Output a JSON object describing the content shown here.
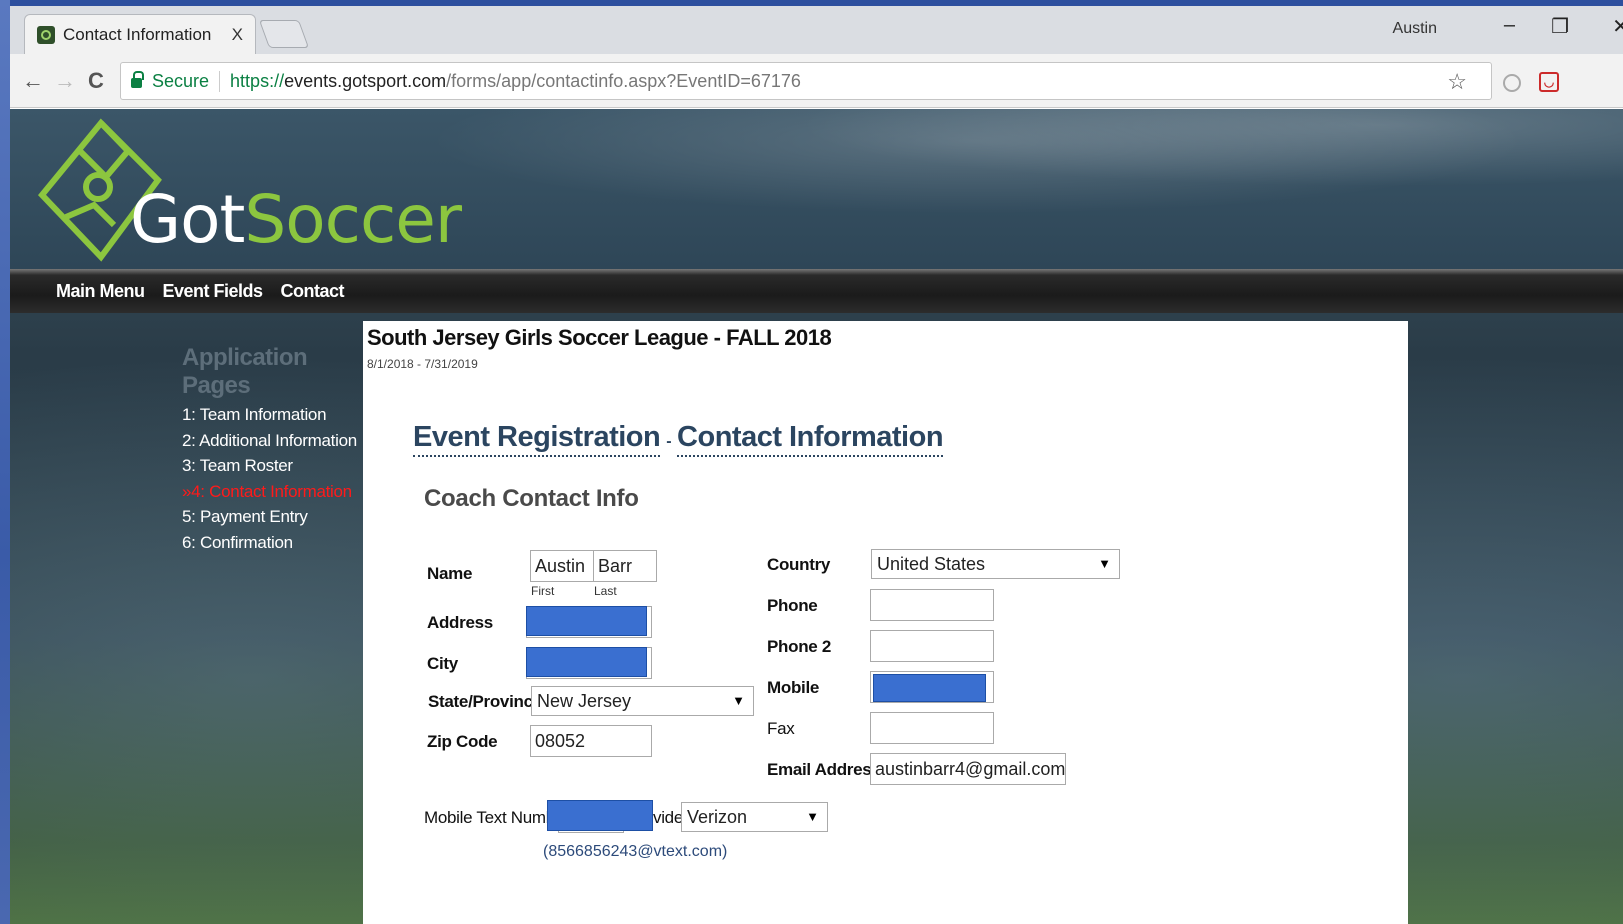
{
  "browser": {
    "tab_title": "Contact Information",
    "tab_close": "X",
    "user": "Austin",
    "minimize": "–",
    "restore": "❐",
    "close": "✕",
    "secure": "Secure",
    "url_scheme": "https://",
    "url_host": "events.gotsport.com",
    "url_path": "/forms/app/contactinfo.aspx?EventID=67176",
    "back": "←",
    "forward": "→",
    "reload": "C",
    "star": "☆"
  },
  "site": {
    "logo_got": "Got",
    "logo_soccer": "Soccer",
    "nav": [
      "Main Menu",
      "Event Fields",
      "Contact"
    ]
  },
  "sidebar": {
    "title": "Application Pages",
    "items": [
      {
        "label": "1: Team Information"
      },
      {
        "label": "2: Additional Information"
      },
      {
        "label": "3: Team Roster"
      },
      {
        "label": "»4: Contact Information",
        "active": true
      },
      {
        "label": "5: Payment Entry"
      },
      {
        "label": "6: Confirmation"
      }
    ]
  },
  "event": {
    "title": "South Jersey Girls Soccer League - FALL 2018",
    "dates": "8/1/2018 - 7/31/2019"
  },
  "heading": {
    "part1": "Event Registration",
    "sep": "-",
    "part2": "Contact Information"
  },
  "section_title": "Coach Contact Info",
  "form": {
    "name_label": "Name",
    "first_value": "Austin",
    "last_value": "Barr",
    "first_sub": "First",
    "last_sub": "Last",
    "address_label": "Address",
    "city_label": "City",
    "state_label": "State/Province",
    "state_value": "New Jersey",
    "zip_label": "Zip Code",
    "zip_value": "08052",
    "country_label": "Country",
    "country_value": "United States",
    "phone_label": "Phone",
    "phone2_label": "Phone 2",
    "mobile_label": "Mobile",
    "fax_label": "Fax",
    "email_label": "Email Address",
    "email_value": "austinbarr4@gmail.com",
    "mobile_text_label": "Mobile Text Numbe",
    "provider_label": "vider",
    "provider_value": "Verizon",
    "text_email_hint": "(8566856243@vtext.com)"
  },
  "colors": {
    "redaction": "#3a6fd0",
    "active_item": "#ff1a1a",
    "logo_green": "#8cc63f"
  }
}
